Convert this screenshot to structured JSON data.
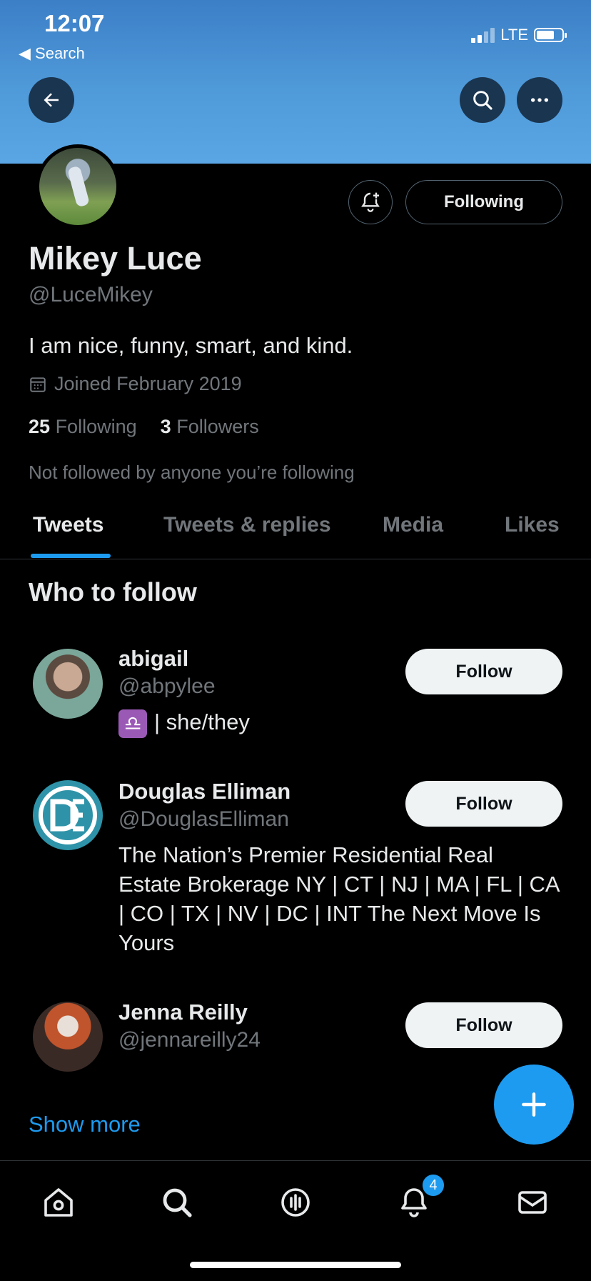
{
  "status_bar": {
    "time": "12:07",
    "back_label": "◀ Search",
    "network": "LTE"
  },
  "profile": {
    "name": "Mikey Luce",
    "handle": "@LuceMikey",
    "bio": "I am nice, funny, smart, and kind.",
    "joined": "Joined February 2019",
    "following_count": "25",
    "following_label": "Following",
    "followers_count": "3",
    "followers_label": "Followers",
    "not_followed_text": "Not followed by anyone you’re following",
    "following_button": "Following"
  },
  "tabs": [
    {
      "label": "Tweets",
      "active": true
    },
    {
      "label": "Tweets & replies",
      "active": false
    },
    {
      "label": "Media",
      "active": false
    },
    {
      "label": "Likes",
      "active": false
    }
  ],
  "who_to_follow": {
    "title": "Who to follow",
    "users": [
      {
        "name": "abigail",
        "handle": "@abpylee",
        "bio_icon": "♎",
        "bio": "| she/they",
        "button": "Follow"
      },
      {
        "name": "Douglas Elliman",
        "handle": "@DouglasElliman",
        "bio": "The Nation’s Premier Residential Real Estate Brokerage NY | CT | NJ | MA | FL | CA | CO | TX | NV | DC | INT The Next Move Is Yours",
        "button": "Follow"
      },
      {
        "name": "Jenna Reilly",
        "handle": "@jennareilly24",
        "bio": "",
        "button": "Follow"
      }
    ],
    "show_more": "Show more"
  },
  "nav": {
    "items": [
      "home-icon",
      "search-icon",
      "spaces-icon",
      "notifications-icon",
      "messages-icon"
    ],
    "notification_badge": "4"
  },
  "colors": {
    "accent": "#1d9bf0",
    "background": "#000000",
    "header": "#4f9ad9"
  }
}
